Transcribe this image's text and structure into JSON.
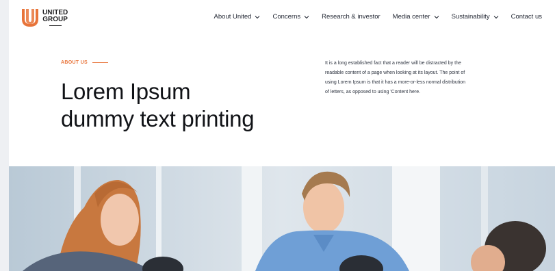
{
  "brand": {
    "line1": "UNITED",
    "line2": "GROUP",
    "accent": "#e8743a"
  },
  "nav": {
    "items": [
      {
        "label": "About United",
        "dropdown": true
      },
      {
        "label": "Concerns",
        "dropdown": true
      },
      {
        "label": "Research & investor",
        "dropdown": false
      },
      {
        "label": "Media center",
        "dropdown": true
      },
      {
        "label": "Sustainability",
        "dropdown": true
      },
      {
        "label": "Contact us",
        "dropdown": false
      }
    ]
  },
  "hero": {
    "eyebrow": "ABOUT US",
    "headline_line1": "Lorem Ipsum",
    "headline_line2": "dummy text printing",
    "blurb": "It is a long established fact that a reader will be distracted by the readable content of a page when looking at its layout. The point of using Lorem Ipsum is that it has a more-or-less normal distribution of letters, as opposed to using 'Content here."
  },
  "icons": {
    "logo": "united-group-logo-icon",
    "chevron": "chevron-down-icon"
  }
}
